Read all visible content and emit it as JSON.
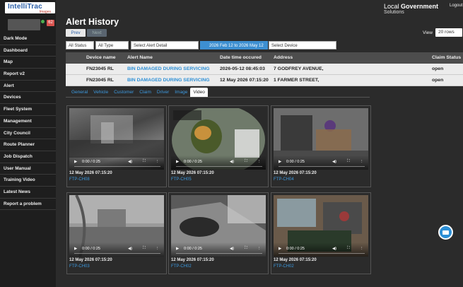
{
  "app": {
    "logo_main": "IntelliTrac",
    "logo_sub": "Images",
    "notification_count": "62",
    "org_name_prefix": "Local ",
    "org_name_bold": "Government",
    "org_sub": "Solutions",
    "logout_label": "Logout"
  },
  "sidebar": {
    "items": [
      {
        "label": "Dark Mode"
      },
      {
        "label": "Dashboard"
      },
      {
        "label": "Map"
      },
      {
        "label": "Report v2"
      },
      {
        "label": "Alert"
      },
      {
        "label": "Devices"
      },
      {
        "label": "Fleet System"
      },
      {
        "label": "Management"
      },
      {
        "label": "City Council"
      },
      {
        "label": "Route Planner"
      },
      {
        "label": "Job Dispatch"
      },
      {
        "label": "User Manual"
      },
      {
        "label": "Training Video"
      },
      {
        "label": "Latest News"
      },
      {
        "label": "Report a problem"
      }
    ]
  },
  "page": {
    "title": "Alert History",
    "prev_label": "Prev",
    "next_label": "Next",
    "view_label": "View",
    "view_value": "20 rows"
  },
  "filters": {
    "status": "All Status",
    "type": "All Type",
    "alert_detail": "Select Alert Detail",
    "date_range": "2026 Feb 12 to 2026 May 12",
    "device": "Select Device"
  },
  "table": {
    "headers": [
      "",
      "Device name",
      "Alert Name",
      "Date time occured",
      "Address",
      "Claim Status"
    ],
    "rows": [
      {
        "device": "FN23045 RL",
        "alert": "BIN DAMAGED DURING SERVICING",
        "datetime": "2026-05-12 08:45:03",
        "address": "7 GODFREY AVENUE,",
        "claim": "open"
      },
      {
        "device": "FN23045 RL",
        "alert": "BIN DAMAGED DURING SERVICING",
        "datetime": "12 May 2026 07:15:20",
        "address": "1 FARMER STREET,",
        "claim": "open"
      }
    ]
  },
  "tabs": [
    "General",
    "Vehicle",
    "Customer",
    "Claim",
    "Driver",
    "Image",
    "Video"
  ],
  "active_tab": "Video",
  "videos": [
    {
      "time": "0:00 / 0:25",
      "date": "12 May 2026 07:15:20",
      "channel": "FTP-CH08"
    },
    {
      "time": "0:00 / 0:25",
      "date": "12 May 2026 07:15:20",
      "channel": "FTP-CH05"
    },
    {
      "time": "0:00 / 0:25",
      "date": "12 May 2026 07:15:20",
      "channel": "FTP-CH04"
    },
    {
      "time": "0:00 / 0:25",
      "date": "12 May 2026 07:15:20",
      "channel": "FTP-CH03"
    },
    {
      "time": "0:00 / 0:25",
      "date": "12 May 2026 07:15:20",
      "channel": "FTP-CH02"
    },
    {
      "time": "0:00 / 0:25",
      "date": "12 May 2026 07:15:20",
      "channel": "FTP-CH02"
    }
  ],
  "colors": {
    "accent": "#2c8fd6",
    "sidebar_bg": "#1e1e1e",
    "page_bg": "#2b2b2b",
    "badge": "#d9534f"
  }
}
